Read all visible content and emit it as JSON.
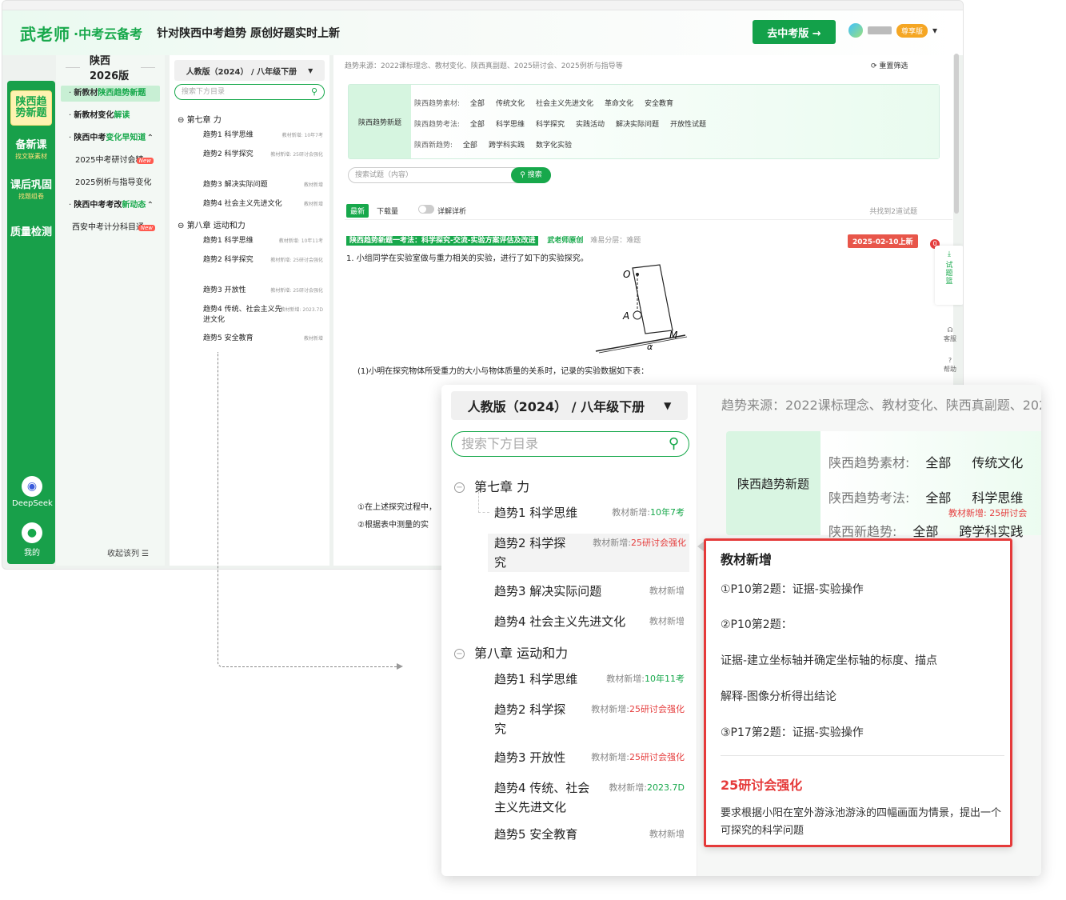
{
  "header": {
    "logo": "武老师",
    "logo_sub": "·中考云备考",
    "slogan": "针对陕西中考趋势 原创好题实时上新",
    "cta": "去中考版 →",
    "vip": "尊享版"
  },
  "leftnav": {
    "items": [
      {
        "label": "陕西趋势新题",
        "sub": ""
      },
      {
        "label": "备新课",
        "sub": "找文联素材"
      },
      {
        "label": "课后巩固",
        "sub": "找题组卷"
      },
      {
        "label": "质量检测",
        "sub": ""
      }
    ],
    "deepseek": "DeepSeek",
    "new": "New",
    "mine": "我的"
  },
  "subnav": {
    "title": "陕西2026版",
    "items": [
      {
        "a": "新教材",
        "b": "陕西趋势新题"
      },
      {
        "a": "新教材变化",
        "b": "解读"
      },
      {
        "a": "陕西中考",
        "b": "变化早知道"
      },
      {
        "a": "2025中考研讨会精",
        "b": ""
      },
      {
        "a": "2025例析与指导变化",
        "b": ""
      },
      {
        "a": "陕西中考考改",
        "b": "新动态"
      },
      {
        "a": "西安中考计分科目通",
        "b": ""
      }
    ],
    "collapse": "收起该列 ☰"
  },
  "tree": {
    "select": "人教版（2024） / 八年级下册",
    "placeholder": "搜索下方目录",
    "chapters": [
      "第七章 力",
      "第八章 运动和力"
    ],
    "items7": [
      {
        "t": "趋势1 科学思维",
        "tag": "教材新增: 10年7考"
      },
      {
        "t": "趋势2 科学探究",
        "tag": "教材新增: 25研讨会强化"
      },
      {
        "t": "趋势3 解决实际问题",
        "tag": "教材新增"
      },
      {
        "t": "趋势4 社会主义先进文化",
        "tag": "教材新增"
      }
    ],
    "items8": [
      {
        "t": "趋势1 科学思维",
        "tag": "教材新增: 10年11考"
      },
      {
        "t": "趋势2 科学探究",
        "tag": "教材新增: 25研讨会强化"
      },
      {
        "t": "趋势3 开放性",
        "tag": "教材新增: 25研讨会强化"
      },
      {
        "t": "趋势4 传统、社会主义先进文化",
        "tag": "教材新增: 2023.7D"
      },
      {
        "t": "趋势5 安全教育",
        "tag": "教材新增"
      }
    ]
  },
  "main": {
    "source": "趋势来源：2022课标理念、教材变化、陕西真副题、2025研讨会、2025例析与指导等",
    "reset": "重置筛选",
    "filter_label": "陕西趋势新题",
    "row1_key": "陕西趋势素材:",
    "row1": [
      "全部",
      "传统文化",
      "社会主义先进文化",
      "革命文化",
      "安全教育"
    ],
    "row2_key": "陕西趋势考法:",
    "row2": [
      "全部",
      "科学思维",
      "科学探究",
      "实践活动",
      "解决实际问题",
      "开放性试题"
    ],
    "row3_key": "陕西新趋势:",
    "row3": [
      "全部",
      "跨学科实践",
      "数字化实验"
    ],
    "search_placeholder": "搜索试题（内容）",
    "search_btn": "搜索",
    "tab_new": "最新",
    "tab_dl": "下载量",
    "toggle_label": "详解详析",
    "found": "共找到2道试题",
    "q_tag": "陕西趋势新题一考法：科学探究-交流-实验方案评估及改进",
    "q_orig": "武老师原创",
    "q_diff": "难易分层：难题",
    "q_date": "2025-02-10上新",
    "q_text": "1. 小组同学在实验室做与重力相关的实验，进行了如下的实验探究。",
    "q_sub1": "(1)小明在探究物体所受重力的大小与物体质量的关系时，记录的实验数据如下表：",
    "q_sub2": "①在上述探究过程中，",
    "q_sub3": "②根据表中测量的实",
    "label_O": "O",
    "label_A": "A",
    "label_M": "M",
    "label_alpha": "α",
    "badge": "0",
    "tool": "试题篮",
    "kefu": "客服",
    "help": "帮助"
  },
  "zoom": {
    "select": "人教版（2024） / 八年级下册",
    "placeholder": "搜索下方目录",
    "ch7": "第七章 力",
    "ch8": "第八章 运动和力",
    "i7": [
      {
        "t": "趋势1 科学思维",
        "tag": "教材新增:",
        "tag2": "10年7考",
        "c": "g"
      },
      {
        "t": "趋势2 科学探",
        "t2": "究",
        "tag": "教材新增:",
        "tag2": "25研讨会强化",
        "c": "r"
      },
      {
        "t": "趋势3 解决实际问题",
        "tag": "教材新增",
        "tag2": "",
        "c": ""
      },
      {
        "t": "趋势4 社会主义先进文化",
        "tag": "教材新增",
        "tag2": "",
        "c": ""
      }
    ],
    "i8": [
      {
        "t": "趋势1 科学思维",
        "tag": "教材新增:",
        "tag2": "10年11考",
        "c": "g"
      },
      {
        "t": "趋势2 科学探",
        "t2": "究",
        "tag": "教材新增:",
        "tag2": "25研讨会强化",
        "c": "r"
      },
      {
        "t": "趋势3 开放性",
        "tag": "教材新增:",
        "tag2": "25研讨会强化",
        "c": "r"
      },
      {
        "t": "趋势4 传统、社会",
        "t2": "主义先进文化",
        "tag": "教材新增:",
        "tag2": "2023.7D",
        "c": "g"
      },
      {
        "t": "趋势5 安全教育",
        "tag": "教材新增",
        "tag2": "",
        "c": ""
      }
    ],
    "src": "趋势来源：2022课标理念、教材变化、陕西真副题、2025研",
    "filter_label": "陕西趋势新题",
    "r1k": "陕西趋势素材:",
    "r1": [
      "全部",
      "传统文化"
    ],
    "r2k": "陕西趋势考法:",
    "r2": [
      "全部",
      "科学思维"
    ],
    "r2note": "教材新增: 25研讨会",
    "r3k": "陕西新趋势:",
    "r3": [
      "全部",
      "跨学科实践"
    ]
  },
  "popup": {
    "title": "教材新增",
    "l1": "①P10第2题：证据-实验操作",
    "l2": "②P10第2题：",
    "l3": "证据-建立坐标轴并确定坐标轴的标度、描点",
    "l4": "解释-图像分析得出结论",
    "l5": "③P17第2题：证据-实验操作",
    "title2": "25研讨会强化",
    "long": "要求根据小阳在室外游泳池游泳的四幅画面为情景，提出一个可探究的科学问题"
  }
}
